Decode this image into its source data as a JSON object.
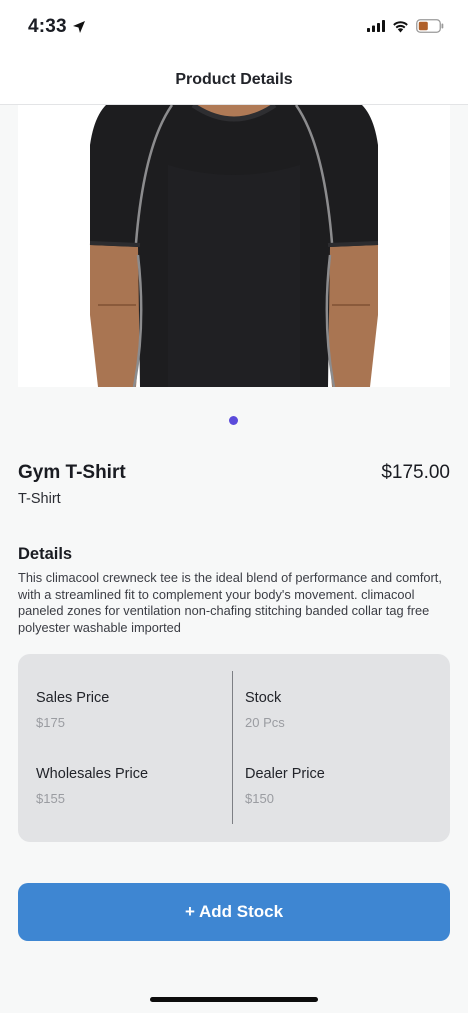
{
  "status_bar": {
    "time": "4:33",
    "icons": [
      "location-arrow-icon",
      "signal-icon",
      "wifi-icon",
      "battery-icon"
    ],
    "battery_color": "#b0602a"
  },
  "header": {
    "title": "Product Details"
  },
  "carousel": {
    "image": "black-gym-t-shirt-photo",
    "active_dot_color": "#5b4bdb"
  },
  "product": {
    "name": "Gym T-Shirt",
    "price": "$175.00",
    "category": "T-Shirt"
  },
  "details": {
    "heading": "Details",
    "text": "This climacool crewneck tee is the ideal blend of performance and comfort, with a streamlined fit to complement your body's movement. climacool paneled zones for ventilation non-chafing stitching banded collar tag free polyester washable imported"
  },
  "prices": {
    "sales_label": "Sales Price",
    "sales_value": "$175",
    "stock_label": "Stock",
    "stock_value": "20 Pcs",
    "wholesale_label": "Wholesales Price",
    "wholesale_value": "$155",
    "dealer_label": "Dealer Price",
    "dealer_value": "$150"
  },
  "actions": {
    "add_stock_label": "+ Add Stock",
    "accent": "#3e86d2"
  }
}
